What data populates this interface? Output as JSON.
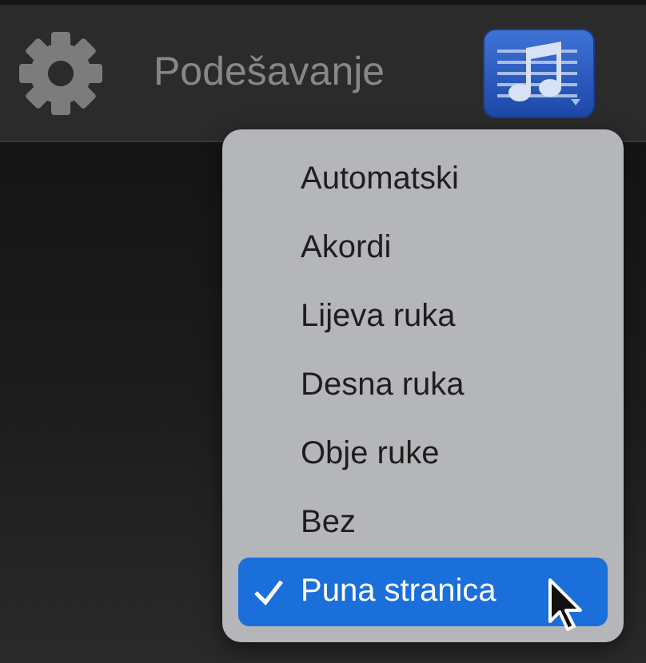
{
  "toolbar": {
    "title": "Podešavanje"
  },
  "menu": {
    "items": [
      {
        "label": "Automatski",
        "selected": false,
        "checked": false
      },
      {
        "label": "Akordi",
        "selected": false,
        "checked": false
      },
      {
        "label": "Lijeva ruka",
        "selected": false,
        "checked": false
      },
      {
        "label": "Desna ruka",
        "selected": false,
        "checked": false
      },
      {
        "label": "Obje ruke",
        "selected": false,
        "checked": false
      },
      {
        "label": "Bez",
        "selected": false,
        "checked": false
      },
      {
        "label": "Puna stranica",
        "selected": true,
        "checked": true
      }
    ]
  }
}
